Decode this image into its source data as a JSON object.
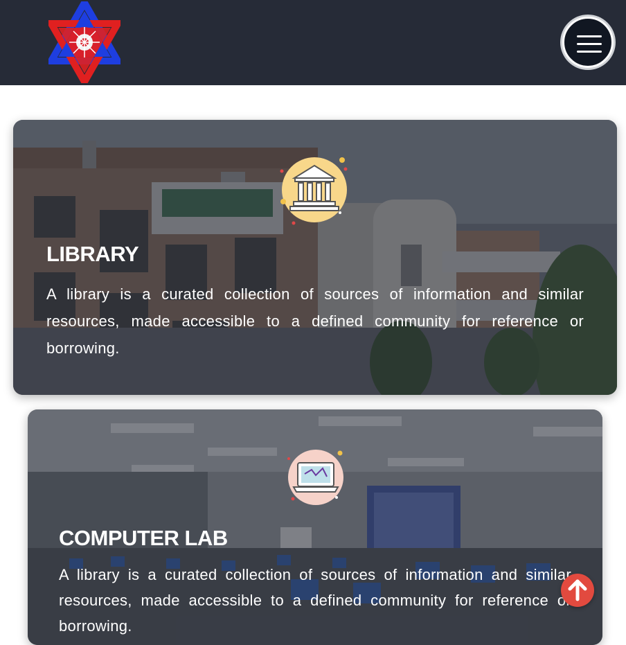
{
  "header": {
    "logo_icon": "university-emblem-icon",
    "menu_icon": "hamburger-menu-icon",
    "background_color": "#262b37"
  },
  "cards": [
    {
      "title": "LIBRARY",
      "text": "A library is a curated collection of sources of information and similar resources, made accessible to a defined community for reference or borrowing.",
      "icon": "library-building-icon",
      "icon_color": "#f8d78a"
    },
    {
      "title": "COMPUTER LAB",
      "text": "A library is a curated collection of sources of information and similar resources, made accessible to a defined community for reference or borrowing.",
      "icon": "laptop-icon",
      "icon_color": "#f6d2c9"
    }
  ],
  "scroll_top": {
    "icon": "arrow-up-icon",
    "color": "#e24a3f"
  }
}
